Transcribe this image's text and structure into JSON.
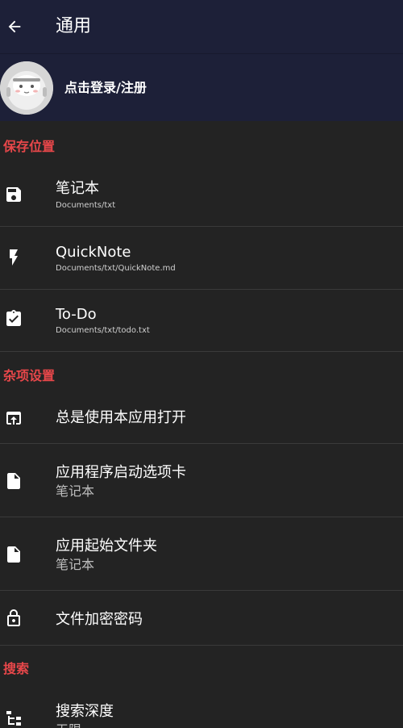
{
  "appbar": {
    "title": "通用"
  },
  "account": {
    "label": "点击登录/注册"
  },
  "sections": {
    "storage": {
      "header": "保存位置",
      "notebook": {
        "title": "笔记本",
        "path": "Documents/txt"
      },
      "quicknote": {
        "title": "QuickNote",
        "path": "Documents/txt/QuickNote.md"
      },
      "todo": {
        "title": "To-Do",
        "path": "Documents/txt/todo.txt"
      }
    },
    "misc": {
      "header": "杂项设置",
      "always_open": {
        "title": "总是使用本应用打开"
      },
      "launch_tab": {
        "title": "应用程序启动选项卡",
        "value": "笔记本"
      },
      "start_folder": {
        "title": "应用起始文件夹",
        "value": "笔记本"
      },
      "encryption": {
        "title": "文件加密密码"
      }
    },
    "search": {
      "header": "搜索",
      "depth": {
        "title": "搜索深度",
        "value": "无限"
      }
    }
  },
  "colors": {
    "appbar_bg": "#1d2038",
    "page_bg": "#232323",
    "section_header": "#e8474a",
    "divider": "#3a3a3a"
  },
  "icons": {
    "back": "arrow-left-icon",
    "notebook": "floppy-disk-icon",
    "quicknote": "lightning-bolt-icon",
    "todo": "clipboard-check-icon",
    "always_open": "open-in-app-icon",
    "launch_tab": "file-icon",
    "start_folder": "file-icon",
    "encryption": "lock-icon",
    "search_depth": "file-tree-icon"
  }
}
